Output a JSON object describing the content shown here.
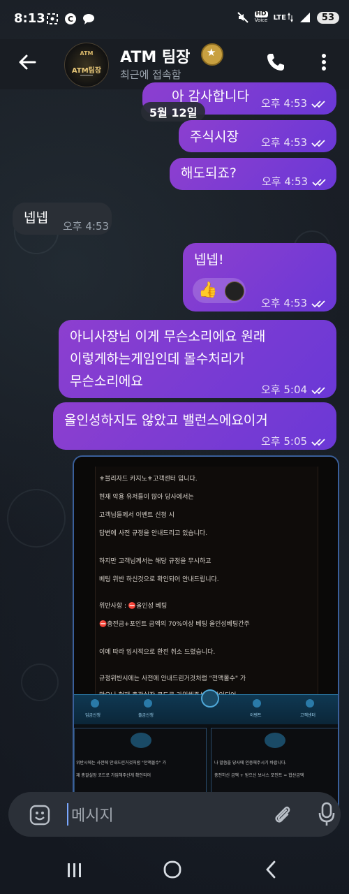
{
  "status_bar": {
    "time": "8:13",
    "hd_label": "HD",
    "voice_label": "Voice",
    "lte_label": "LTE",
    "battery": "53"
  },
  "header": {
    "title": "ATM 팀장",
    "subtitle": "최근에 접속함"
  },
  "date_separator": "5월 12일",
  "messages": [
    {
      "dir": "out",
      "text": "아 감사합니다",
      "time": "오후 4:53"
    },
    {
      "dir": "out",
      "text": "주식시장",
      "time": "오후 4:53"
    },
    {
      "dir": "out",
      "text": "해도되죠?",
      "time": "오후 4:53"
    },
    {
      "dir": "in",
      "text": "넵넵",
      "time": "오후 4:53"
    },
    {
      "dir": "out",
      "text": "넵넵!",
      "time": "오후 4:53",
      "reaction": "👍"
    },
    {
      "dir": "out",
      "text": "아니사장님 이게 무슨소리에요 원래 이렇게하는게임인데 몰수처리가 무슨소리에요",
      "lines": [
        "아니사장님 이게 무슨소리에요 원래",
        "이렇게하는게임인데 몰수처리가",
        "무슨소리에요"
      ],
      "time": "오후 5:04"
    },
    {
      "dir": "out",
      "text": "올인성하지도 않았고 밸런스에요이거",
      "time": "오후 5:05"
    }
  ],
  "image_message": {
    "lines": [
      "⚜블리자드 카지노⚜고객센터 입니다.",
      "현재 악용 유저들이 많아 당사에서는",
      "고객님들께서 이벤트 신청 시",
      "답변에 사전 규정을 안내드리고 있습니다.",
      "하지만 고객님께서는 해당 규정을 무시하고",
      "베팅 위반 하신것으로 확인되어 안내드립니다.",
      "위반사항 : ⛔올인성 베팅",
      "⛔충전금+포인트 금액의 70%이상 베팅 올인성베팅간주",
      "이에 따라 임시적으로 환전 취소 드렸습니다.",
      "규정위반시에는 사전에 안내드린거것처럼 \"전액몰수\" 가",
      "맞으나 현재 총괄실장 코드로 가입해주신게 확인되어"
    ],
    "nav": [
      "입금신청",
      "출금신청",
      "이벤트",
      "고객센터"
    ],
    "left_panel_lines": [
      "위반시에는 사전에 안내드린거것처럼 \"전액몰수\" 가",
      "재 총괄실장 코드로 가입해주신게 확인되어"
    ],
    "right_panel_lines": [
      "나 말씀을 당사에 인증해주시기 바랍니다.",
      "충전하신 금액 + 받으신 보너스 포인트 = 합산금액"
    ]
  },
  "input": {
    "placeholder": "메시지"
  },
  "colors": {
    "outgoing_bubble": "#7a3cd3",
    "incoming_bubble": "#2a2f36",
    "background": "#16191f"
  }
}
